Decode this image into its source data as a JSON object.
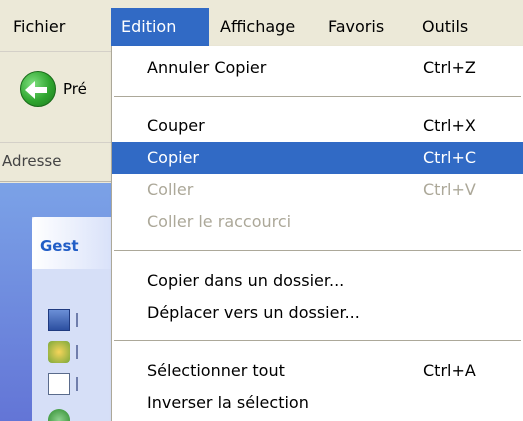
{
  "menubar": {
    "items": [
      "Fichier",
      "Edition",
      "Affichage",
      "Favoris",
      "Outils"
    ],
    "active": "Edition"
  },
  "toolbar": {
    "back_label": "Pré",
    "back_icon": "back-arrow-icon"
  },
  "addressbar": {
    "label": "Adresse"
  },
  "taskpane": {
    "title": "Gest"
  },
  "edit_menu": {
    "items": [
      {
        "label": "Annuler Copier",
        "shortcut": "Ctrl+Z",
        "state": "normal"
      },
      {
        "label": "Couper",
        "shortcut": "Ctrl+X",
        "state": "normal"
      },
      {
        "label": "Copier",
        "shortcut": "Ctrl+C",
        "state": "highlighted"
      },
      {
        "label": "Coller",
        "shortcut": "Ctrl+V",
        "state": "disabled"
      },
      {
        "label": "Coller le raccourci",
        "shortcut": "",
        "state": "disabled"
      },
      {
        "label": "Copier dans un dossier...",
        "shortcut": "",
        "state": "normal"
      },
      {
        "label": "Déplacer vers un dossier...",
        "shortcut": "",
        "state": "normal"
      },
      {
        "label": "Sélectionner tout",
        "shortcut": "Ctrl+A",
        "state": "normal"
      },
      {
        "label": "Inverser la sélection",
        "shortcut": "",
        "state": "normal"
      }
    ]
  },
  "colors": {
    "highlight": "#316ac5",
    "menu_background": "#ffffff",
    "disabled_text": "#aca899",
    "chrome": "#ece9d8",
    "taskpane": "#6375d6"
  }
}
